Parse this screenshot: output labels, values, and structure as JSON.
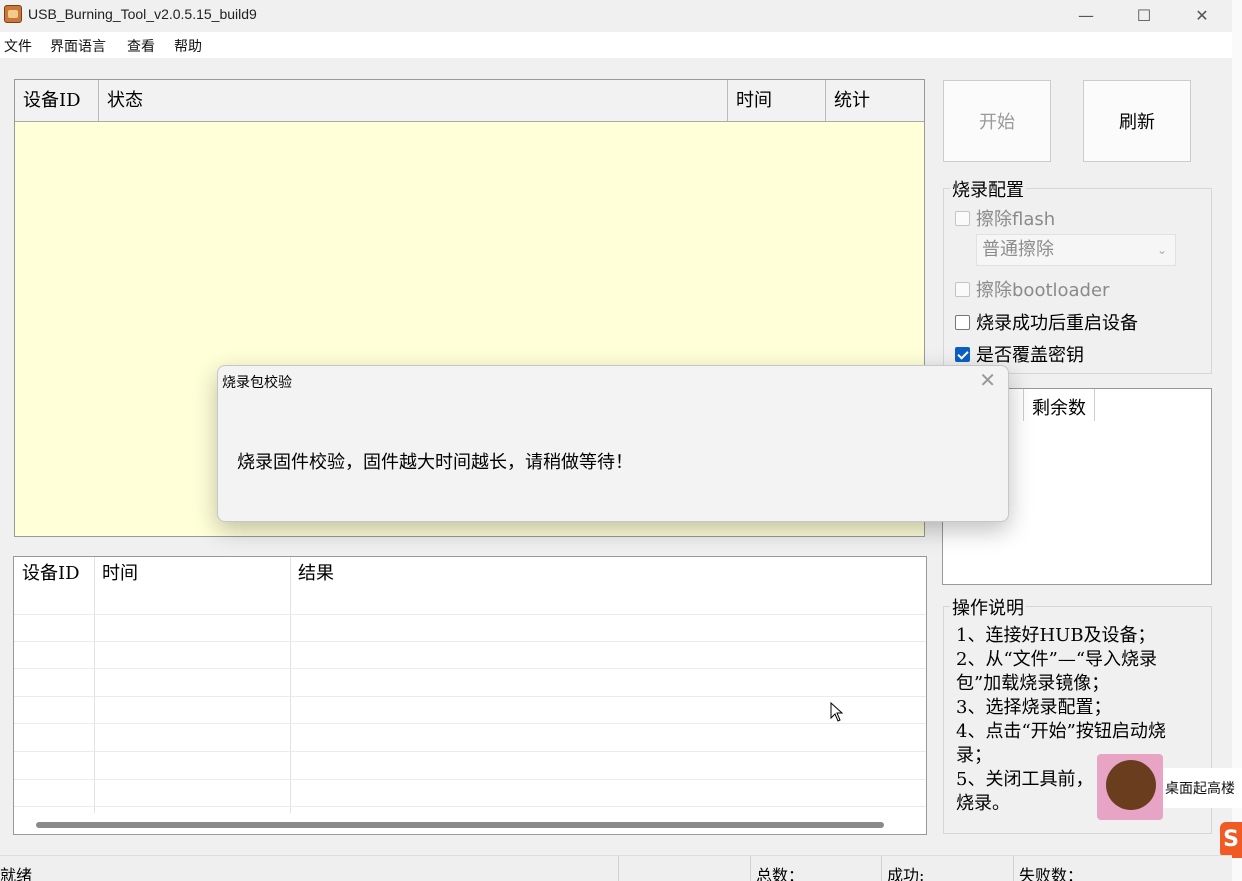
{
  "window": {
    "title": "USB_Burning_Tool_v2.0.5.15_build9",
    "minimize": "—",
    "maximize": "☐",
    "close": "✕"
  },
  "menu": [
    "文件",
    "界面语言",
    "查看",
    "帮助"
  ],
  "device_table": {
    "headers": [
      "设备ID",
      "状态",
      "时间",
      "统计"
    ]
  },
  "log_table": {
    "headers": [
      "设备ID",
      "时间",
      "结果"
    ]
  },
  "buttons": {
    "start": "开始",
    "refresh": "刷新"
  },
  "burn_config": {
    "title": "烧录配置",
    "erase_flash": "擦除flash",
    "erase_mode": "普通擦除",
    "erase_bootloader": "擦除bootloader",
    "reboot_after": "烧录成功后重启设备",
    "overwrite_key": "是否覆盖密钥"
  },
  "remaining_list": {
    "header": "剩余数"
  },
  "instructions": {
    "title": "操作说明",
    "lines": [
      "1、连接好HUB及设备；",
      "2、从“文件”—“导入烧录包”加载烧录镜像；",
      "3、选择烧录配置；",
      "4、点击“开始”按钮启动烧录；",
      "5、关闭工具前，",
      "烧录。"
    ]
  },
  "overlay": {
    "tag": "桌面起高楼",
    "logo": "S"
  },
  "status_bar": {
    "state": "就绪",
    "total": "总数：",
    "success": "成功:",
    "fail": "失败数："
  },
  "dialog": {
    "title": "烧录包校验",
    "close": "✕",
    "message": "烧录固件校验，固件越大时间越长，请稍做等待！"
  }
}
